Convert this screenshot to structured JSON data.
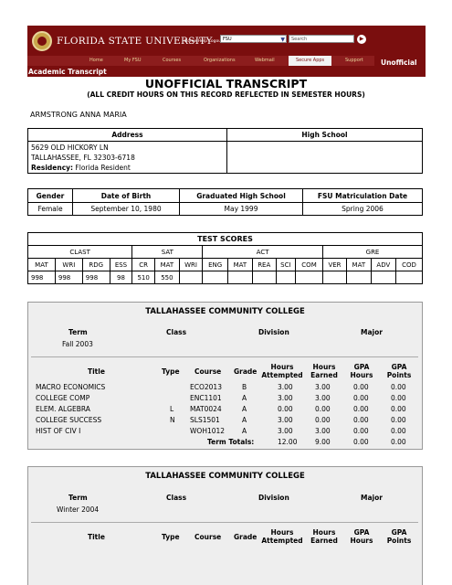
{
  "header": {
    "brand": "FLORIDA STATE UNIVERSITY",
    "top_links": "Home  Help  Logout",
    "select_value": "FSU",
    "search_placeholder": "Search",
    "go_icon": "arrow-right-circle-icon",
    "nav": [
      "Home",
      "My FSU",
      "Courses",
      "Organizations",
      "Webmail",
      "Secure Apps",
      "Support"
    ],
    "nav_active": "Secure Apps",
    "status_tag": "Unofficial",
    "brand_color": "#7a0e0e",
    "accent_color": "#c9a64a"
  },
  "breadcrumb": "Academic Transcript",
  "title": "UNOFFICIAL TRANSCRIPT",
  "subtitle": "(ALL CREDIT HOURS ON THIS RECORD REFLECTED IN SEMESTER HOURS)",
  "student_name": "ARMSTRONG ANNA MARIA",
  "address": {
    "header_address": "Address",
    "header_high_school": "High School",
    "line1": "5629 OLD HICKORY LN",
    "line2": "TALLAHASSEE, FL 32303-6718",
    "residency_label": "Residency:",
    "residency_value": "Florida Resident"
  },
  "info": {
    "headers": [
      "Gender",
      "Date of Birth",
      "Graduated High School",
      "FSU Matriculation Date"
    ],
    "values": [
      "Female",
      "September 10, 1980",
      "May 1999",
      "Spring 2006"
    ]
  },
  "test_scores": {
    "title": "TEST SCORES",
    "groups": [
      "CLAST",
      "SAT",
      "ACT",
      "GRE"
    ],
    "subheads": [
      "MAT",
      "WRI",
      "RDG",
      "ESS",
      "CR",
      "MAT",
      "WRI",
      "ENG",
      "MAT",
      "REA",
      "SCI",
      "COM",
      "VER",
      "MAT",
      "ADV",
      "COD"
    ],
    "values": [
      "998",
      "998",
      "998",
      "98",
      "510",
      "550",
      "",
      "",
      "",
      "",
      "",
      "",
      "",
      "",
      "",
      ""
    ]
  },
  "terms": [
    {
      "college": "TALLAHASSEE COMMUNITY COLLEGE",
      "labels": {
        "term": "Term",
        "class": "Class",
        "division": "Division",
        "major": "Major"
      },
      "term": "Fall 2003",
      "columns": {
        "title": "Title",
        "type": "Type",
        "course": "Course",
        "grade": "Grade",
        "hours_attempted": "Hours Attempted",
        "hours_earned": "Hours Earned",
        "gpa_hours": "GPA Hours",
        "gpa_points": "GPA Points"
      },
      "courses": [
        {
          "title": "MACRO ECONOMICS",
          "type": "",
          "course": "ECO2013",
          "grade": "B",
          "att": "3.00",
          "earn": "3.00",
          "gpah": "0.00",
          "gpap": "0.00"
        },
        {
          "title": "COLLEGE COMP",
          "type": "",
          "course": "ENC1101",
          "grade": "A",
          "att": "3.00",
          "earn": "3.00",
          "gpah": "0.00",
          "gpap": "0.00"
        },
        {
          "title": "ELEM. ALGEBRA",
          "type": "L",
          "course": "MAT0024",
          "grade": "A",
          "att": "0.00",
          "earn": "0.00",
          "gpah": "0.00",
          "gpap": "0.00"
        },
        {
          "title": "COLLEGE SUCCESS",
          "type": "N",
          "course": "SLS1501",
          "grade": "A",
          "att": "3.00",
          "earn": "0.00",
          "gpah": "0.00",
          "gpap": "0.00"
        },
        {
          "title": "HIST OF CIV I",
          "type": "",
          "course": "WOH1012",
          "grade": "A",
          "att": "3.00",
          "earn": "3.00",
          "gpah": "0.00",
          "gpap": "0.00"
        }
      ],
      "totals": {
        "label": "Term Totals:",
        "att": "12.00",
        "earn": "9.00",
        "gpah": "0.00",
        "gpap": "0.00"
      }
    },
    {
      "college": "TALLAHASSEE COMMUNITY COLLEGE",
      "labels": {
        "term": "Term",
        "class": "Class",
        "division": "Division",
        "major": "Major"
      },
      "term": "Winter 2004",
      "columns": {
        "title": "Title",
        "type": "Type",
        "course": "Course",
        "grade": "Grade",
        "hours_attempted": "Hours Attempted",
        "hours_earned": "Hours Earned",
        "gpa_hours": "GPA Hours",
        "gpa_points": "GPA Points"
      }
    }
  ]
}
